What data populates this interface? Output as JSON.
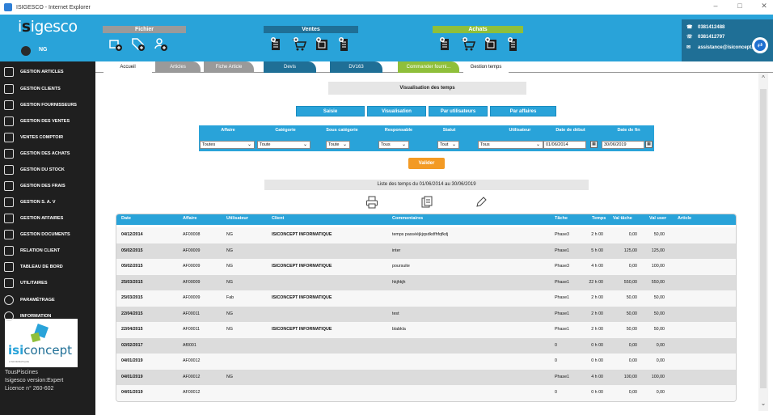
{
  "window": {
    "title": "ISIGESCO - Internet Explorer",
    "controls": [
      "–",
      "□",
      "✕"
    ]
  },
  "header": {
    "brand_prefix": "i",
    "brand_mark": "s",
    "brand_suffix": "igesco",
    "user": "NG",
    "groups": [
      {
        "label": "Fichier",
        "color": "#9a9a9a",
        "icons": [
          "add-box-icon",
          "add-tag-icon",
          "add-user-icon"
        ]
      },
      {
        "label": "Ventes",
        "color": "#1f6f96",
        "icons": [
          "doc-icon",
          "cart-icon",
          "invoice-icon",
          "receipt-icon"
        ]
      },
      {
        "label": "Achats",
        "color": "#8fbf3a",
        "icons": [
          "doc-icon",
          "cart-icon",
          "invoice-icon",
          "receipt-icon"
        ]
      }
    ],
    "contact": {
      "phone1": "0381412488",
      "phone2": "0381412797",
      "email": "assistance@isiconcept.fr"
    }
  },
  "sidebar": {
    "items": [
      {
        "label": "GESTION ARTICLES",
        "icon": "box-icon"
      },
      {
        "label": "GESTION CLIENTS",
        "icon": "client-icon"
      },
      {
        "label": "GESTION FOURNISSEURS",
        "icon": "supplier-icon"
      },
      {
        "label": "GESTION DES VENTES",
        "icon": "sales-icon"
      },
      {
        "label": "VENTES COMPTOIR",
        "icon": "counter-icon"
      },
      {
        "label": "GESTION DES ACHATS",
        "icon": "bag-icon"
      },
      {
        "label": "GESTION DU STOCK",
        "icon": "stock-icon"
      },
      {
        "label": "GESTION DES FRAIS",
        "icon": "wallet-icon"
      },
      {
        "label": "GESTION S. A. V",
        "icon": "wrench-icon"
      },
      {
        "label": "GESTION AFFAIRES",
        "icon": "briefcase-icon"
      },
      {
        "label": "GESTION DOCUMENTS",
        "icon": "folder-icon"
      },
      {
        "label": "RELATION CLIENT",
        "icon": "contact-icon"
      },
      {
        "label": "TABLEAU DE BORD",
        "icon": "chart-icon"
      },
      {
        "label": "UTILITAIRES",
        "icon": "tools-icon"
      },
      {
        "label": "PARAMÉTRAGE",
        "icon": "settings-icon"
      },
      {
        "label": "INFORMATION",
        "icon": "info-icon"
      }
    ],
    "promo": {
      "brand1": "isi",
      "brand2": "concept",
      "sub": "L'INFORMATIQUE"
    },
    "client": "TousPiscines",
    "version": "Isigesco version:Expert",
    "licence": "Licence n° 260-602"
  },
  "tabs": [
    {
      "label": "Accueil",
      "bg": "#ffffff",
      "fg": "#111111"
    },
    {
      "label": "Articles",
      "bg": "#9a9a9a",
      "fg": "#ffffff"
    },
    {
      "label": "Fiche Article",
      "bg": "#9a9a9a",
      "fg": "#ffffff"
    },
    {
      "label": "Devis",
      "bg": "#1f6f96",
      "fg": "#ffffff"
    },
    {
      "label": "DV163",
      "bg": "#1f6f96",
      "fg": "#ffffff"
    },
    {
      "label": "Commander fourni...",
      "bg": "#8fbf3a",
      "fg": "#ffffff"
    },
    {
      "label": "Gestion temps",
      "bg": "#ffffff",
      "fg": "#111111"
    }
  ],
  "page": {
    "title": "Visualisation des temps",
    "view_buttons": [
      "Saisie",
      "Visualisation",
      "Par utilisateurs",
      "Par affaires"
    ],
    "filter_headers": [
      "Affaire",
      "Catégorie",
      "Sous catégorie",
      "Responsable",
      "Statut",
      "Utilisateur",
      "Date de début",
      "Date de fin"
    ],
    "filter_values": {
      "affaire": "Toutes",
      "categorie": "Toute",
      "sous_categorie": "Toute",
      "responsable": "Tous",
      "statut": "Tout",
      "utilisateur": "Tous",
      "date_debut": "01/06/2014",
      "date_fin": "30/06/2019"
    },
    "validate_label": "Valider",
    "list_title": "Liste des temps du 01/06/2014 au 30/06/2019",
    "tools": [
      "print-icon",
      "export-icon",
      "edit-icon"
    ]
  },
  "table": {
    "columns": [
      "Date",
      "Affaire",
      "Utilisateur",
      "Client",
      "Commentaires",
      "Tâche",
      "Temps",
      "Val tâche",
      "Val user",
      "Article"
    ],
    "rows": [
      [
        "04/12/2014",
        "AF00008",
        "NG",
        "ISICONCEPT INFORMATIQUE",
        "temps passééjkjqsdkdfhfqfkdj",
        "Phase3",
        "2 h 00",
        "0,00",
        "50,00",
        ""
      ],
      [
        "05/02/2015",
        "AF00009",
        "NG",
        "",
        "inter",
        "Phase1",
        "5 h 00",
        "125,00",
        "125,00",
        ""
      ],
      [
        "05/02/2015",
        "AF00009",
        "NG",
        "ISICONCEPT INFORMATIQUE",
        "poursuite",
        "Phase3",
        "4 h 00",
        "0,00",
        "100,00",
        ""
      ],
      [
        "25/03/2015",
        "AF00009",
        "NG",
        "",
        "hkjhkjh",
        "Phase1",
        "22 h 00",
        "550,00",
        "550,00",
        ""
      ],
      [
        "25/03/2015",
        "AF00009",
        "Fab",
        "ISICONCEPT INFORMATIQUE",
        "",
        "Phase1",
        "2 h 00",
        "50,00",
        "50,00",
        ""
      ],
      [
        "22/04/2015",
        "AF00011",
        "NG",
        "",
        "test",
        "Phase1",
        "2 h 00",
        "50,00",
        "50,00",
        ""
      ],
      [
        "22/04/2015",
        "AF00011",
        "NG",
        "ISICONCEPT INFORMATIQUE",
        "blabkla",
        "Phase1",
        "2 h 00",
        "50,00",
        "50,00",
        ""
      ],
      [
        "02/02/2017",
        "Af0001",
        "",
        "",
        "",
        "0",
        "0 h 00",
        "0,00",
        "0,00",
        ""
      ],
      [
        "04/01/2019",
        "AF00012",
        "",
        "",
        "",
        "0",
        "0 h 00",
        "0,00",
        "0,00",
        ""
      ],
      [
        "04/01/2019",
        "AF00012",
        "NG",
        "",
        "",
        "Phase1",
        "4 h 00",
        "100,00",
        "100,00",
        ""
      ],
      [
        "04/01/2019",
        "AF00012",
        "",
        "",
        "",
        "0",
        "0 h 00",
        "0,00",
        "0,00",
        ""
      ]
    ]
  }
}
